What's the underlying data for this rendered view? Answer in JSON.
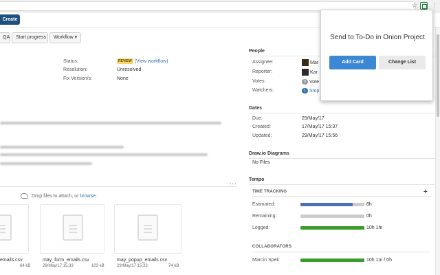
{
  "toolbar": {
    "create_label": "Create",
    "qa_label": "QA",
    "start_progress_label": "Start progress",
    "workflow_label": "Workflow",
    "workflow_caret": "▾"
  },
  "details": {
    "status_label": "Status:",
    "status_badge": "REVIEW",
    "view_workflow_link": "(View workflow)",
    "resolution_label": "Resolution:",
    "resolution_value": "Unresolved",
    "fix_versions_label": "Fix Version/s:",
    "fix_versions_value": "None"
  },
  "attachments": {
    "drop_text": "Drop files to attach, or",
    "browse_link": "browse.",
    "more": "...",
    "files": [
      {
        "name": "emails.csv",
        "date": "",
        "size": "64 kB"
      },
      {
        "name": "may_form_emails.csv",
        "date": "29/May/17 15:33",
        "size": "103 kB"
      },
      {
        "name": "may_popup_emails.csv",
        "date": "29/May/17 15:33",
        "size": "74 kB"
      }
    ]
  },
  "people": {
    "heading": "People",
    "assignee_label": "Assignee:",
    "assignee_value": "Mar",
    "reporter_label": "Reporter:",
    "reporter_value": "Kar",
    "votes_label": "Votes:",
    "votes_count": "0",
    "votes_link": "Vote",
    "watchers_label": "Watchers:",
    "watchers_count": "1",
    "watchers_link": "Stop"
  },
  "dates": {
    "heading": "Dates",
    "due_label": "Due:",
    "due_value": "29/May/17",
    "created_label": "Created:",
    "created_value": "17/May/17 15:37",
    "updated_label": "Updated:",
    "updated_value": "29/May/17 15:56"
  },
  "drawio": {
    "heading": "Draw.io Diagrams",
    "empty": "No Files"
  },
  "tempo": {
    "heading": "Tempo",
    "time_tracking_heading": "TIME TRACKING",
    "estimated_label": "Estimated:",
    "estimated_value": "8h",
    "estimated_fraction": 0.82,
    "remaining_label": "Remaining:",
    "remaining_value": "0h",
    "remaining_fraction": 0,
    "logged_label": "Logged:",
    "logged_value": "10h 1m",
    "logged_fraction": 1,
    "collaborators_heading": "COLLABORATORS",
    "collaborator_name": "Marcin Spek",
    "collaborator_value": "10h 1m / 0h",
    "collaborator_fraction": 1,
    "colors": {
      "estimated": "#4a6fb5",
      "logged": "#3c9b2f",
      "track": "#cccccc"
    }
  },
  "popup": {
    "title": "Send to To-Do in Onion Project",
    "add_card_label": "Add Card",
    "change_list_label": "Change List"
  },
  "browser": {
    "star_icon": "☆",
    "menu_icon": "⋮"
  }
}
